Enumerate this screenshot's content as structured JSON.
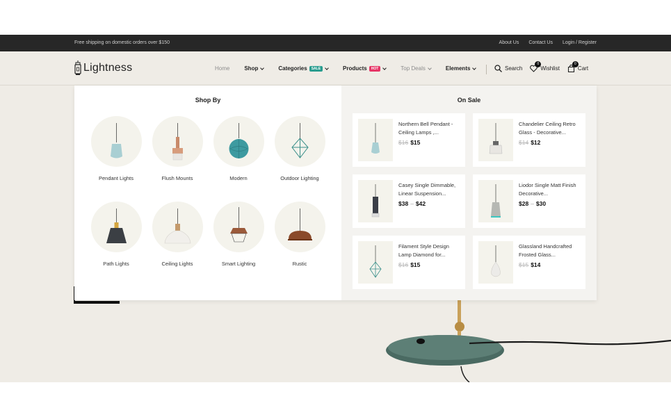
{
  "topbar": {
    "shipping": "Free shipping on domestic orders over $150",
    "links": [
      "About Us",
      "Contact Us",
      "Login / Register"
    ]
  },
  "brand": {
    "name": "Lightness"
  },
  "nav": {
    "items": [
      {
        "label": "Home"
      },
      {
        "label": "Shop"
      },
      {
        "label": "Categories",
        "badge": "SALE"
      },
      {
        "label": "Products",
        "badge": "HOT"
      },
      {
        "label": "Top Deals"
      },
      {
        "label": "Elements"
      }
    ]
  },
  "tools": {
    "search": "Search",
    "wishlist": "Wishlist",
    "wishlist_count": "0",
    "cart": "Cart",
    "cart_count": "0"
  },
  "mega": {
    "shop_by_title": "Shop By",
    "on_sale_title": "On Sale",
    "categories": [
      {
        "label": "Pendant Lights",
        "icon": "pendant-lamp-icon"
      },
      {
        "label": "Flush Mounts",
        "icon": "flush-mount-icon"
      },
      {
        "label": "Modern",
        "icon": "modern-lamp-icon"
      },
      {
        "label": "Outdoor Lighting",
        "icon": "outdoor-lamp-icon"
      },
      {
        "label": "Path Lights",
        "icon": "path-lamp-icon"
      },
      {
        "label": "Ceiling Lights",
        "icon": "ceiling-lamp-icon"
      },
      {
        "label": "Smart Lighting",
        "icon": "smart-lamp-icon"
      },
      {
        "label": "Rustic",
        "icon": "rustic-lamp-icon"
      }
    ],
    "products": [
      {
        "name": "Northern Bell Pendant - Ceiling Lamps ,...",
        "old_price": "$16",
        "price": "$15"
      },
      {
        "name": "Chandelier Ceiling Retro Glass - Decorative...",
        "old_price": "$14",
        "price": "$12"
      },
      {
        "name": "Casey Single Dimmable, Linear Suspension...",
        "price_min": "$38",
        "price_sep": "–",
        "price_max": "$42"
      },
      {
        "name": "Liodor Single Matt Finish Decorative...",
        "price_min": "$28",
        "price_sep": "–",
        "price_max": "$30"
      },
      {
        "name": "Filament Style Design Lamp Diamond for...",
        "old_price": "$16",
        "price": "$15"
      },
      {
        "name": "Glassland Handcrafted Frosted Glass...",
        "old_price": "$15",
        "price": "$14"
      }
    ]
  },
  "colors": {
    "sale_badge": "#2a9d8f",
    "hot_badge": "#e63566",
    "hero_bg": "#efece6",
    "topbar_bg": "#272727"
  }
}
